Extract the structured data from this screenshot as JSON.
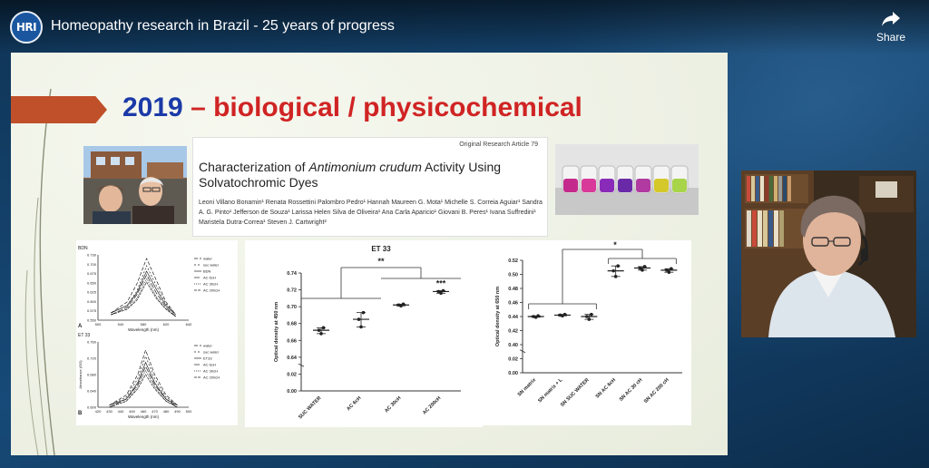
{
  "header": {
    "logo_text": "HRI",
    "title": "Homeopathy research in Brazil - 25 years of progress",
    "share_label": "Share"
  },
  "slide": {
    "heading_year": "2019",
    "heading_rest": " – biological / physicochemical",
    "paper": {
      "header_text": "Original Research Article   79",
      "title_1": "Characterization of ",
      "title_italic": "Antimonium crudum",
      "title_2": " Activity Using Solvatochromic Dyes",
      "authors": "Leoni Villano Bonamin¹  Renata Rossettini Palombro Pedro¹  Hannah Maureen G. Mota¹  Michelle S. Correia Aguiar¹  Sandra A. G. Pinto¹  Jefferson de Souza¹  Larissa Helen Silva de Oliveira¹  Ana Carla Aparicio¹  Giovani B. Peres¹  Ivana Suffredini¹  Maristela Dutra-Correa¹  Steven J. Cartwright²"
    }
  },
  "chart_data": [
    {
      "type": "line",
      "title": "",
      "panels": [
        {
          "label": "A",
          "heading": "BDN",
          "xlabel": "Wavelength (nm)",
          "xlim": [
            500,
            640
          ],
          "x_ticks": [
            "500",
            "540",
            "580",
            "620",
            "640"
          ],
          "ylim": [
            0.55,
            0.73
          ],
          "y_ticks": [
            "0.730",
            "0.700",
            "0.675",
            "0.650",
            "0.625",
            "0.600",
            "0.575",
            "0.550"
          ],
          "legend": [
            "water",
            "suc water",
            "BDN",
            "AC 6cH",
            "AC 30cH",
            "AC 200cH"
          ],
          "series": [
            {
              "name": "water",
              "x": [
                520,
                545,
                560,
                575,
                590,
                605,
                620
              ],
              "y": [
                0.57,
                0.6,
                0.65,
                0.72,
                0.66,
                0.6,
                0.565
              ]
            },
            {
              "name": "suc water",
              "x": [
                520,
                545,
                560,
                575,
                590,
                605,
                620
              ],
              "y": [
                0.57,
                0.59,
                0.63,
                0.7,
                0.645,
                0.595,
                0.565
              ]
            },
            {
              "name": "BDN",
              "x": [
                520,
                545,
                560,
                575,
                590,
                605,
                620
              ],
              "y": [
                0.57,
                0.59,
                0.625,
                0.685,
                0.635,
                0.59,
                0.565
              ]
            },
            {
              "name": "AC 6cH",
              "x": [
                520,
                545,
                560,
                575,
                590,
                605,
                620
              ],
              "y": [
                0.565,
                0.585,
                0.62,
                0.675,
                0.625,
                0.585,
                0.56
              ]
            },
            {
              "name": "AC 30cH",
              "x": [
                520,
                545,
                560,
                575,
                590,
                605,
                620
              ],
              "y": [
                0.565,
                0.58,
                0.61,
                0.665,
                0.615,
                0.58,
                0.56
              ]
            },
            {
              "name": "AC 200cH",
              "x": [
                520,
                545,
                560,
                575,
                590,
                605,
                620
              ],
              "y": [
                0.565,
                0.58,
                0.605,
                0.655,
                0.61,
                0.58,
                0.56
              ]
            }
          ]
        },
        {
          "label": "B",
          "heading": "ET 33",
          "ylabel": "Absorbance (OD)",
          "xlabel": "Wavelength (nm)",
          "xlim": [
            420,
            500
          ],
          "x_ticks": [
            "420",
            "430",
            "440",
            "450",
            "460",
            "470",
            "480",
            "490",
            "500"
          ],
          "ylim": [
            0.6,
            0.76
          ],
          "y_ticks": [
            "0.760",
            "0.720",
            "0.680",
            "0.640",
            "0.600"
          ],
          "legend": [
            "water",
            "suc water",
            "ET33",
            "AC 6cH",
            "AC 30cH",
            "AC 200cH"
          ],
          "series": [
            {
              "name": "water",
              "x": [
                430,
                445,
                455,
                462,
                470,
                480,
                490
              ],
              "y": [
                0.605,
                0.63,
                0.68,
                0.74,
                0.68,
                0.63,
                0.605
              ]
            },
            {
              "name": "suc water",
              "x": [
                430,
                445,
                455,
                462,
                470,
                480,
                490
              ],
              "y": [
                0.605,
                0.625,
                0.67,
                0.725,
                0.67,
                0.625,
                0.605
              ]
            },
            {
              "name": "ET33",
              "x": [
                430,
                445,
                455,
                462,
                470,
                480,
                490
              ],
              "y": [
                0.605,
                0.62,
                0.66,
                0.71,
                0.66,
                0.62,
                0.605
              ]
            },
            {
              "name": "AC 6cH",
              "x": [
                430,
                445,
                455,
                462,
                470,
                480,
                490
              ],
              "y": [
                0.6,
                0.62,
                0.655,
                0.7,
                0.655,
                0.62,
                0.6
              ]
            },
            {
              "name": "AC 30cH",
              "x": [
                430,
                445,
                455,
                462,
                470,
                480,
                490
              ],
              "y": [
                0.6,
                0.615,
                0.65,
                0.69,
                0.65,
                0.615,
                0.6
              ]
            },
            {
              "name": "AC 200cH",
              "x": [
                430,
                445,
                455,
                462,
                470,
                480,
                490
              ],
              "y": [
                0.6,
                0.615,
                0.645,
                0.68,
                0.645,
                0.615,
                0.6
              ]
            }
          ]
        }
      ]
    },
    {
      "type": "scatter",
      "title": "ET 33",
      "ylabel": "Optical density at 450 nm",
      "categories": [
        "SUC WATER",
        "AC 6cH",
        "AC 30cH",
        "AC 200cH"
      ],
      "ylim": [
        0,
        0.74
      ],
      "y_ticks": [
        "0.74",
        "0.72",
        "0.70",
        "0.68",
        "0.66",
        "0.64",
        "0.02",
        "0.00"
      ],
      "points": [
        [
          0.672,
          0.668,
          0.675
        ],
        [
          0.685,
          0.676,
          0.693
        ],
        [
          0.702,
          0.701,
          0.703
        ],
        [
          0.718,
          0.716,
          0.719
        ]
      ],
      "means": [
        0.672,
        0.685,
        0.702,
        0.718
      ],
      "annotations": [
        "**",
        "***"
      ]
    },
    {
      "type": "scatter",
      "title": "",
      "ylabel": "Optical density at 650 nm",
      "categories": [
        "SN matrix",
        "SN matrix + L",
        "SN SUC WATER",
        "SN AC 6cH",
        "SN AC 30 cH",
        "SN AC 200 cH"
      ],
      "ylim": [
        0,
        0.52
      ],
      "y_ticks": [
        "0.52",
        "0.50",
        "0.48",
        "0.46",
        "0.44",
        "0.42",
        "0.40",
        "0.02",
        "0.00"
      ],
      "points": [
        [
          0.44,
          0.439,
          0.441
        ],
        [
          0.442,
          0.441,
          0.443
        ],
        [
          0.44,
          0.436,
          0.443
        ],
        [
          0.505,
          0.497,
          0.512
        ],
        [
          0.509,
          0.506,
          0.511
        ],
        [
          0.506,
          0.503,
          0.508
        ]
      ],
      "means": [
        0.44,
        0.442,
        0.44,
        0.505,
        0.509,
        0.506
      ],
      "annotations": [
        "*"
      ]
    }
  ]
}
